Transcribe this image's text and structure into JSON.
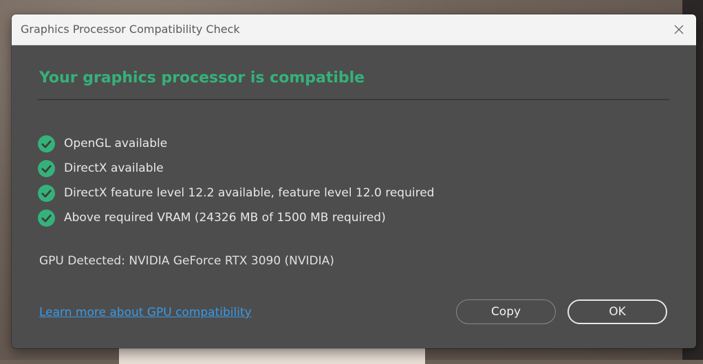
{
  "window": {
    "title": "Graphics Processor Compatibility Check"
  },
  "status": {
    "headline": "Your graphics processor is compatible",
    "accent_color": "#34b27a"
  },
  "checks": [
    {
      "label": "OpenGL available",
      "icon": "check-circle-icon"
    },
    {
      "label": "DirectX available",
      "icon": "check-circle-icon"
    },
    {
      "label": "DirectX feature level 12.2 available, feature level 12.0 required",
      "icon": "check-circle-icon"
    },
    {
      "label": "Above required VRAM (24326 MB of 1500 MB required)",
      "icon": "check-circle-icon"
    }
  ],
  "gpu": {
    "detected_text": "GPU Detected: NVIDIA GeForce RTX 3090 (NVIDIA)"
  },
  "footer": {
    "link_label": "Learn more about GPU compatibility",
    "link_color": "#3a9ae6",
    "copy_label": "Copy",
    "ok_label": "OK"
  }
}
